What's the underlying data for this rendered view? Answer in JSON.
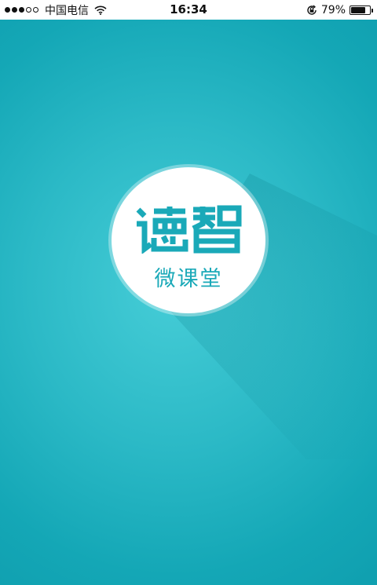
{
  "status_bar": {
    "carrier": "中国电信",
    "time": "16:34",
    "battery_percent": "79%",
    "battery_level": 0.79,
    "signal_strength": 3,
    "signal_total": 5
  },
  "splash": {
    "logo_text": "德智",
    "subtitle": "微课堂"
  },
  "colors": {
    "brand": "#1aa9b8",
    "background": "#2bb9c6"
  },
  "icons": [
    "wifi-icon",
    "orientation-lock-icon",
    "battery-icon"
  ]
}
